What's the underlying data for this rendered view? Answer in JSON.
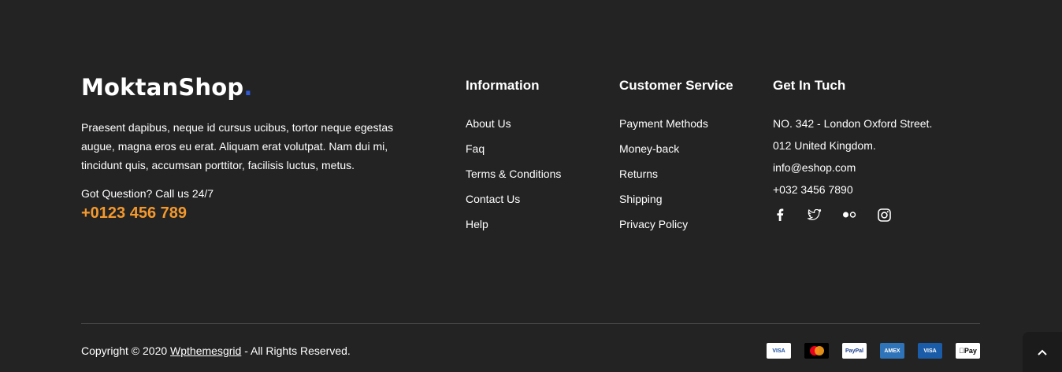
{
  "brand": {
    "name": "MoktanShop",
    "dot": ".",
    "about": "Praesent dapibus, neque id cursus ucibus, tortor neque egestas augue, magna eros eu erat. Aliquam erat volutpat. Nam dui mi, tincidunt quis, accumsan porttitor, facilisis luctus, metus.",
    "question": "Got Question? Call us 24/7",
    "phone": "+0123 456 789"
  },
  "information": {
    "title": "Information",
    "links": [
      "About Us",
      "Faq",
      "Terms & Conditions",
      "Contact Us",
      "Help"
    ]
  },
  "customer_service": {
    "title": "Customer Service",
    "links": [
      "Payment Methods",
      "Money-back",
      "Returns",
      "Shipping",
      "Privacy Policy"
    ]
  },
  "contact": {
    "title": "Get In Tuch",
    "address_line1": "NO. 342 - London Oxford Street.",
    "address_line2": "012 United Kingdom.",
    "email": "info@eshop.com",
    "phone": "+032 3456 7890",
    "socials": [
      "facebook-icon",
      "twitter-icon",
      "flickr-icon",
      "instagram-icon"
    ]
  },
  "bottom": {
    "copyright_prefix": "Copyright © 2020 ",
    "copyright_link": "Wpthemesgrid",
    "copyright_suffix": " - All Rights Reserved.",
    "payments": [
      {
        "name": "visa",
        "label": "VISA"
      },
      {
        "name": "mastercard",
        "label": ""
      },
      {
        "name": "paypal",
        "label": "PayPal"
      },
      {
        "name": "american-express",
        "label": "AMEX"
      },
      {
        "name": "visa-electron",
        "label": "VISA"
      },
      {
        "name": "apple-pay",
        "label": "Pay"
      }
    ]
  },
  "colors": {
    "background": "#232323",
    "accent_orange": "#f3992e",
    "logo_dot": "#2f5bd6"
  }
}
